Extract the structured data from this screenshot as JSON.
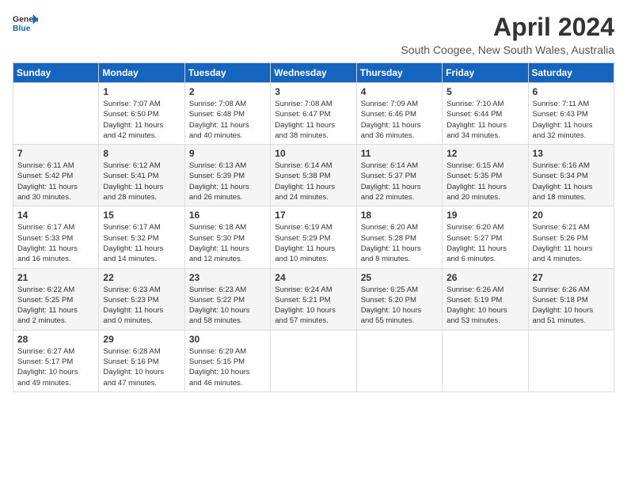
{
  "header": {
    "logo": {
      "general": "General",
      "blue": "Blue"
    },
    "title": "April 2024",
    "location": "South Coogee, New South Wales, Australia"
  },
  "calendar": {
    "days_of_week": [
      "Sunday",
      "Monday",
      "Tuesday",
      "Wednesday",
      "Thursday",
      "Friday",
      "Saturday"
    ],
    "weeks": [
      [
        {
          "day": "",
          "info": ""
        },
        {
          "day": "1",
          "info": "Sunrise: 7:07 AM\nSunset: 6:50 PM\nDaylight: 11 hours\nand 42 minutes."
        },
        {
          "day": "2",
          "info": "Sunrise: 7:08 AM\nSunset: 6:48 PM\nDaylight: 11 hours\nand 40 minutes."
        },
        {
          "day": "3",
          "info": "Sunrise: 7:08 AM\nSunset: 6:47 PM\nDaylight: 11 hours\nand 38 minutes."
        },
        {
          "day": "4",
          "info": "Sunrise: 7:09 AM\nSunset: 6:46 PM\nDaylight: 11 hours\nand 36 minutes."
        },
        {
          "day": "5",
          "info": "Sunrise: 7:10 AM\nSunset: 6:44 PM\nDaylight: 11 hours\nand 34 minutes."
        },
        {
          "day": "6",
          "info": "Sunrise: 7:11 AM\nSunset: 6:43 PM\nDaylight: 11 hours\nand 32 minutes."
        }
      ],
      [
        {
          "day": "7",
          "info": "Sunrise: 6:11 AM\nSunset: 5:42 PM\nDaylight: 11 hours\nand 30 minutes."
        },
        {
          "day": "8",
          "info": "Sunrise: 6:12 AM\nSunset: 5:41 PM\nDaylight: 11 hours\nand 28 minutes."
        },
        {
          "day": "9",
          "info": "Sunrise: 6:13 AM\nSunset: 5:39 PM\nDaylight: 11 hours\nand 26 minutes."
        },
        {
          "day": "10",
          "info": "Sunrise: 6:14 AM\nSunset: 5:38 PM\nDaylight: 11 hours\nand 24 minutes."
        },
        {
          "day": "11",
          "info": "Sunrise: 6:14 AM\nSunset: 5:37 PM\nDaylight: 11 hours\nand 22 minutes."
        },
        {
          "day": "12",
          "info": "Sunrise: 6:15 AM\nSunset: 5:35 PM\nDaylight: 11 hours\nand 20 minutes."
        },
        {
          "day": "13",
          "info": "Sunrise: 6:16 AM\nSunset: 5:34 PM\nDaylight: 11 hours\nand 18 minutes."
        }
      ],
      [
        {
          "day": "14",
          "info": "Sunrise: 6:17 AM\nSunset: 5:33 PM\nDaylight: 11 hours\nand 16 minutes."
        },
        {
          "day": "15",
          "info": "Sunrise: 6:17 AM\nSunset: 5:32 PM\nDaylight: 11 hours\nand 14 minutes."
        },
        {
          "day": "16",
          "info": "Sunrise: 6:18 AM\nSunset: 5:30 PM\nDaylight: 11 hours\nand 12 minutes."
        },
        {
          "day": "17",
          "info": "Sunrise: 6:19 AM\nSunset: 5:29 PM\nDaylight: 11 hours\nand 10 minutes."
        },
        {
          "day": "18",
          "info": "Sunrise: 6:20 AM\nSunset: 5:28 PM\nDaylight: 11 hours\nand 8 minutes."
        },
        {
          "day": "19",
          "info": "Sunrise: 6:20 AM\nSunset: 5:27 PM\nDaylight: 11 hours\nand 6 minutes."
        },
        {
          "day": "20",
          "info": "Sunrise: 6:21 AM\nSunset: 5:26 PM\nDaylight: 11 hours\nand 4 minutes."
        }
      ],
      [
        {
          "day": "21",
          "info": "Sunrise: 6:22 AM\nSunset: 5:25 PM\nDaylight: 11 hours\nand 2 minutes."
        },
        {
          "day": "22",
          "info": "Sunrise: 6:23 AM\nSunset: 5:23 PM\nDaylight: 11 hours\nand 0 minutes."
        },
        {
          "day": "23",
          "info": "Sunrise: 6:23 AM\nSunset: 5:22 PM\nDaylight: 10 hours\nand 58 minutes."
        },
        {
          "day": "24",
          "info": "Sunrise: 6:24 AM\nSunset: 5:21 PM\nDaylight: 10 hours\nand 57 minutes."
        },
        {
          "day": "25",
          "info": "Sunrise: 6:25 AM\nSunset: 5:20 PM\nDaylight: 10 hours\nand 55 minutes."
        },
        {
          "day": "26",
          "info": "Sunrise: 6:26 AM\nSunset: 5:19 PM\nDaylight: 10 hours\nand 53 minutes."
        },
        {
          "day": "27",
          "info": "Sunrise: 6:26 AM\nSunset: 5:18 PM\nDaylight: 10 hours\nand 51 minutes."
        }
      ],
      [
        {
          "day": "28",
          "info": "Sunrise: 6:27 AM\nSunset: 5:17 PM\nDaylight: 10 hours\nand 49 minutes."
        },
        {
          "day": "29",
          "info": "Sunrise: 6:28 AM\nSunset: 5:16 PM\nDaylight: 10 hours\nand 47 minutes."
        },
        {
          "day": "30",
          "info": "Sunrise: 6:29 AM\nSunset: 5:15 PM\nDaylight: 10 hours\nand 46 minutes."
        },
        {
          "day": "",
          "info": ""
        },
        {
          "day": "",
          "info": ""
        },
        {
          "day": "",
          "info": ""
        },
        {
          "day": "",
          "info": ""
        }
      ]
    ]
  }
}
